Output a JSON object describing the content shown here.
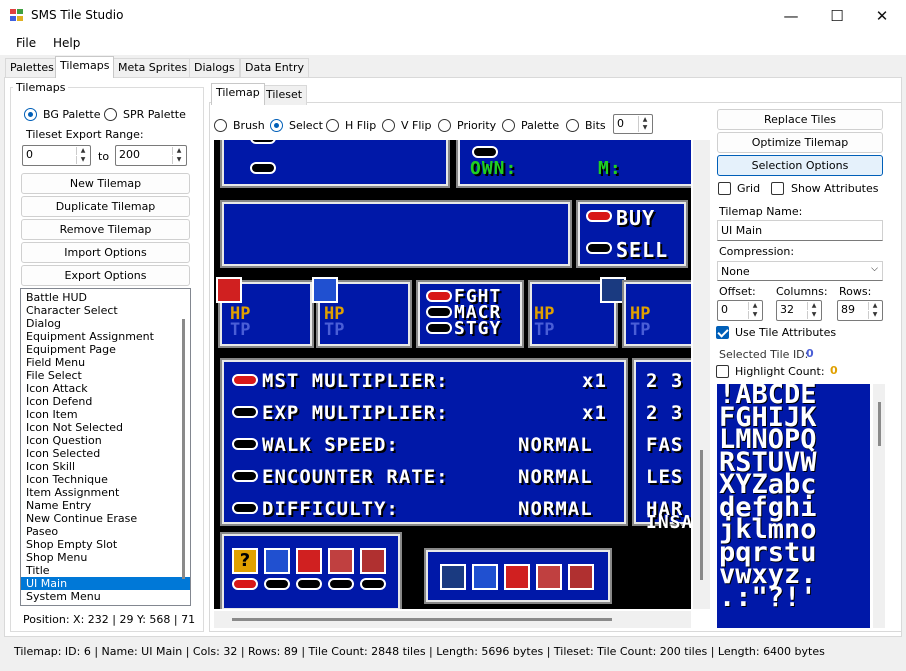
{
  "window": {
    "title": "SMS Tile Studio",
    "minimize": "—",
    "maximize": "☐",
    "close": "✕"
  },
  "menu": {
    "file": "File",
    "help": "Help"
  },
  "tabs": [
    "Palettes",
    "Tilemaps",
    "Meta Sprites",
    "Dialogs",
    "Data Entry"
  ],
  "left": {
    "group_title": "Tilemaps",
    "bg_palette": "BG Palette",
    "spr_palette": "SPR Palette",
    "export_range_label": "Tileset Export Range:",
    "range_from": "0",
    "range_to_label": "to",
    "range_to": "200",
    "buttons": [
      "New Tilemap",
      "Duplicate Tilemap",
      "Remove Tilemap",
      "Import Options",
      "Export Options"
    ],
    "list": [
      "Battle HUD",
      "Character Select",
      "Dialog",
      "Equipment Assignment",
      "Equipment Page",
      "Field Menu",
      "File Select",
      "Icon Attack",
      "Icon Defend",
      "Icon Item",
      "Icon Not Selected",
      "Icon Question",
      "Icon Selected",
      "Icon Skill",
      "Icon Technique",
      "Item Assignment",
      "Name Entry",
      "New Continue Erase",
      "Paseo",
      "Shop Empty Slot",
      "Shop Menu",
      "Title",
      "UI Main",
      "System Menu"
    ],
    "selected_index": 22,
    "position": "Position: X: 232 | 29 Y: 568 | 71"
  },
  "subtabs": [
    "Tilemap",
    "Tileset"
  ],
  "tools": {
    "brush": "Brush",
    "select": "Select",
    "hflip": "H Flip",
    "vflip": "V Flip",
    "priority": "Priority",
    "palette": "Palette",
    "bits": "Bits",
    "bits_value": "0"
  },
  "canvas": {
    "top_right_a": "OWN:",
    "top_right_b": "M:",
    "buy": "BUY",
    "sell": "SELL",
    "hp": "HP",
    "tp": "TP",
    "fght": "FGHT",
    "macr": "MACR",
    "stgy": "STGY",
    "rows": [
      {
        "label": "MST MULTIPLIER:",
        "value": "x1",
        "extra": "2 3"
      },
      {
        "label": "EXP MULTIPLIER:",
        "value": "x1",
        "extra": "2 3"
      },
      {
        "label": "WALK SPEED:",
        "value": "NORMAL",
        "extra": "FAS"
      },
      {
        "label": "ENCOUNTER RATE:",
        "value": "NORMAL",
        "extra": "LES"
      },
      {
        "label": "DIFFICULTY:",
        "value": "NORMAL",
        "extra": "HAR"
      }
    ],
    "insa": "INSA",
    "question": "?"
  },
  "right": {
    "replace_tiles": "Replace Tiles",
    "optimize_tilemap": "Optimize Tilemap",
    "selection_options": "Selection Options",
    "grid": "Grid",
    "show_attributes": "Show Attributes",
    "tilemap_name_label": "Tilemap Name:",
    "tilemap_name": "UI Main",
    "compression_label": "Compression:",
    "compression": "None",
    "offset_label": "Offset:",
    "offset": "0",
    "columns_label": "Columns:",
    "columns": "32",
    "rows_label": "Rows:",
    "rows": "89",
    "use_tile_attributes": "Use Tile Attributes",
    "selected_tile_label": "Selected Tile ID:",
    "selected_tile_value": "0",
    "highlight_count_label": "Highlight Count:",
    "highlight_count_value": "0",
    "tileset_rows": [
      "!ABCDE",
      "FGHIJK",
      "LMNOPQ",
      "RSTUVW",
      "XYZabc",
      "defghi",
      "jklmno",
      "pqrstu",
      "vwxyz.",
      ".:\"?!'"
    ]
  },
  "status": "Tilemap: ID: 6 | Name: UI Main | Cols: 32 | Rows: 89 | Tile Count: 2848 tiles | Length: 5696 bytes | Tileset: Tile Count: 200 tiles | Length: 6400 bytes",
  "colors": {
    "accent": "#005fb8",
    "canvas_blue": "#0018a8",
    "selection": "#0078d7",
    "label_blue": "#4a5ed6",
    "label_orange": "#e0a000"
  }
}
